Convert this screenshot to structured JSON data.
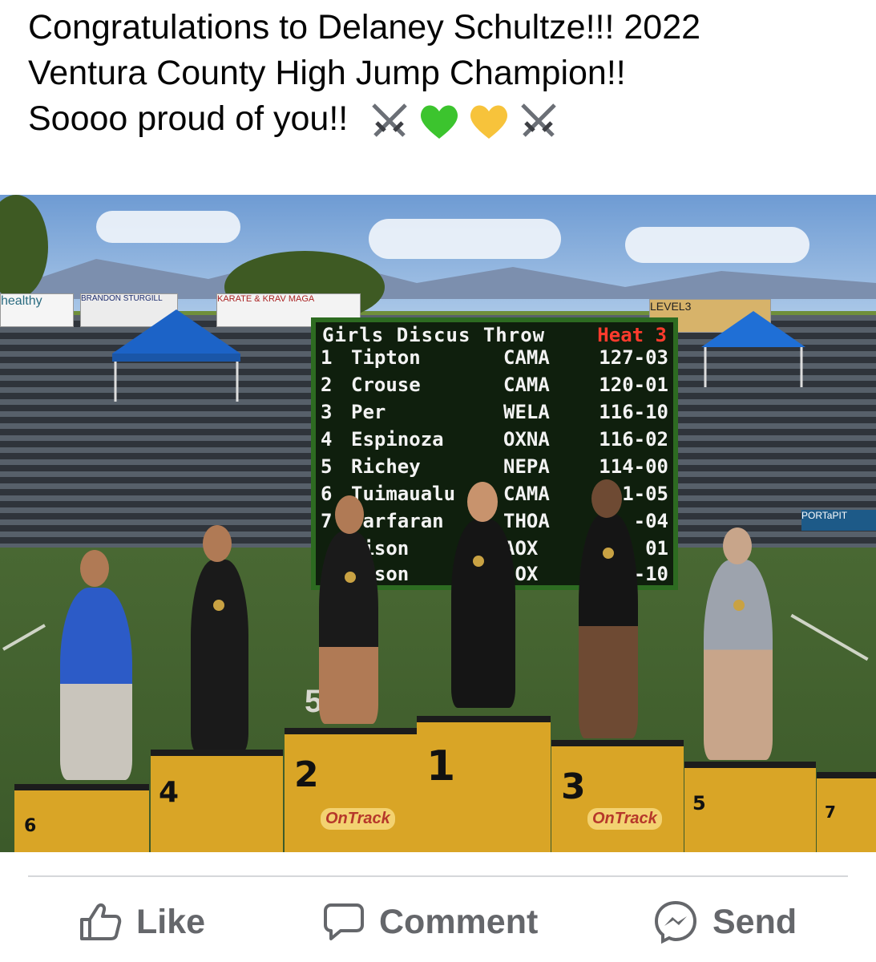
{
  "post": {
    "text_lines": [
      "Congratulations to Delaney Schultze!!! 2022",
      "Ventura County High Jump Champion!!",
      "Soooo proud of you!!"
    ],
    "emoji_icons": [
      "crossed-swords-icon",
      "green-heart-icon",
      "yellow-heart-icon",
      "crossed-swords-icon"
    ]
  },
  "photo": {
    "scoreboard": {
      "title": "Girls Discus Throw",
      "heat": "Heat 3",
      "rows": [
        {
          "place": "1",
          "name": "Tipton",
          "team": "CAMA",
          "mark": "127-03"
        },
        {
          "place": "2",
          "name": "Crouse",
          "team": "CAMA",
          "mark": "120-01"
        },
        {
          "place": "3",
          "name": "Per",
          "team": "WELA",
          "mark": "116-10"
        },
        {
          "place": "4",
          "name": "Espinoza",
          "team": "OXNA",
          "mark": "116-02"
        },
        {
          "place": "5",
          "name": "Richey",
          "team": "NEPA",
          "mark": "114-00"
        },
        {
          "place": "6",
          "name": "Tuimaualu",
          "team": "CAMA",
          "mark": "1-05"
        },
        {
          "place": "7",
          "name": "Tarfaran",
          "team": "THOA",
          "mark": "-04"
        },
        {
          "place": "",
          "name": "lison",
          "team": "AOX",
          "mark": "01"
        },
        {
          "place": "",
          "name": "lison",
          "team": "AOX",
          "mark": "-10"
        }
      ]
    },
    "signs": {
      "healthy": "healthy",
      "level3": "LEVEL3",
      "portapit": "PORTaPIT",
      "karate": "KARATE & KRAV MAGA",
      "sturgill": "BRANDON STURGILL"
    },
    "podium": {
      "p1": "1",
      "p2": "2",
      "p3": "3",
      "p4": "4",
      "p5": "5",
      "p6": "6",
      "p7": "7",
      "brand": "OnTrack",
      "yard_number": "50"
    }
  },
  "actions": {
    "like_label": "Like",
    "comment_label": "Comment",
    "send_label": "Send"
  },
  "colors": {
    "action_gray": "#65676b",
    "text": "#050505"
  }
}
